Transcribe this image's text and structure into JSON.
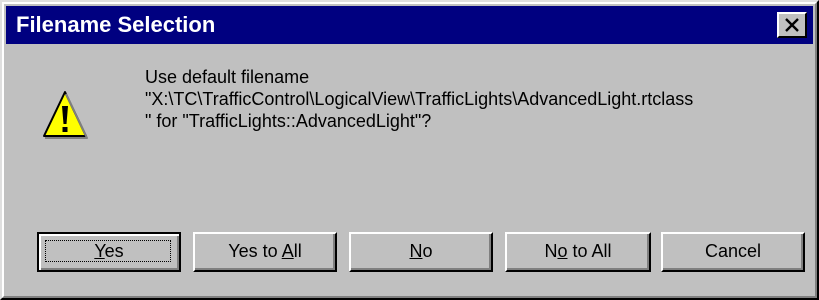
{
  "window": {
    "title": "Filename Selection",
    "close_icon": "close-icon"
  },
  "message": {
    "line1": "Use default filename",
    "line2": "\"X:\\TC\\TrafficControl\\LogicalView\\TrafficLights\\AdvancedLight.rtclass",
    "line3": "\" for \"TrafficLights::AdvancedLight\"?"
  },
  "icon": {
    "name": "warning-icon"
  },
  "buttons": {
    "yes": {
      "pre": "",
      "key": "Y",
      "post": "es"
    },
    "yes_to_all": {
      "pre": "Yes to ",
      "key": "A",
      "post": "ll"
    },
    "no": {
      "pre": "",
      "key": "N",
      "post": "o"
    },
    "no_to_all": {
      "pre": "N",
      "key": "o",
      "post": " to All"
    },
    "cancel": {
      "label": "Cancel"
    }
  },
  "colors": {
    "title_bar": "#000080",
    "dialog_face": "#c0c0c0",
    "warning_fill": "#ffff00"
  }
}
